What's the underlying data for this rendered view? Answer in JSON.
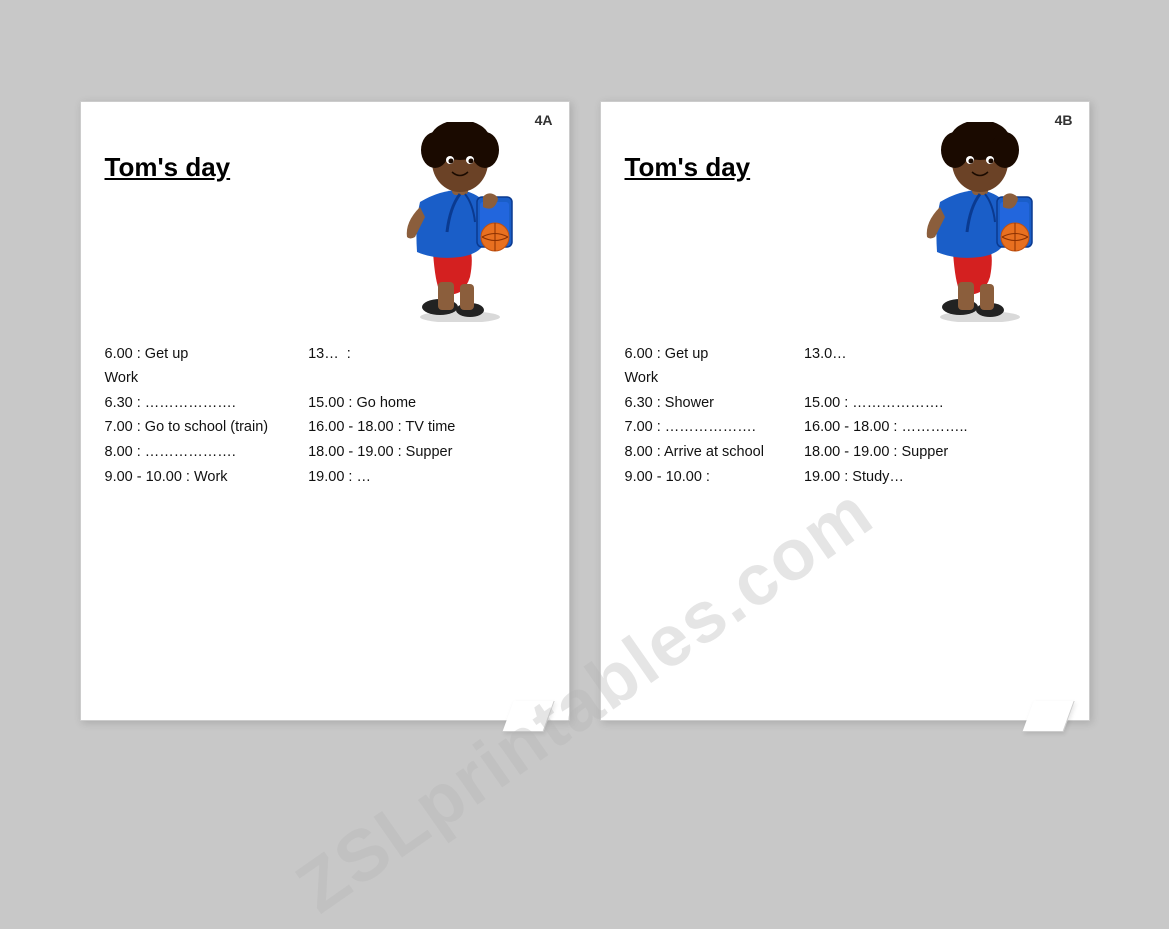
{
  "background": "#c8c8c8",
  "watermark": "ZSLprintables.com",
  "cards": [
    {
      "id": "4A",
      "title": "Tom's day",
      "schedule": [
        {
          "time": "6.00 : Get up",
          "col2": "13...  :"
        },
        {
          "label": "Work"
        },
        {
          "time": "6.30 : ……………….",
          "col2": "15.00 : Go home"
        },
        {
          "time": "7.00 : Go to school (train)",
          "col2": "16.00 - 18.00 : TV time"
        },
        {
          "time": "8.00 : ……………….",
          "col2": "18.00 - 19.00 : Supper"
        },
        {
          "time": "9.00 - 10.00 : Work",
          "col2": "19.00 : …"
        }
      ]
    },
    {
      "id": "4B",
      "title": "Tom's day",
      "schedule": [
        {
          "time": "6.00 : Get up",
          "col2": "13.0…"
        },
        {
          "label": "Work"
        },
        {
          "time": "6.30 : Shower",
          "col2": "15.00 : ………………"
        },
        {
          "time": "7.00 : ……………….",
          "col2": "16.00 - 18.00 : …………."
        },
        {
          "time": "8.00 : Arrive at school",
          "col2": "18.00 - 19.00 : Supper"
        },
        {
          "time": "9.00 - 10.00 :",
          "col2": "19.00 : Study…"
        }
      ]
    }
  ]
}
